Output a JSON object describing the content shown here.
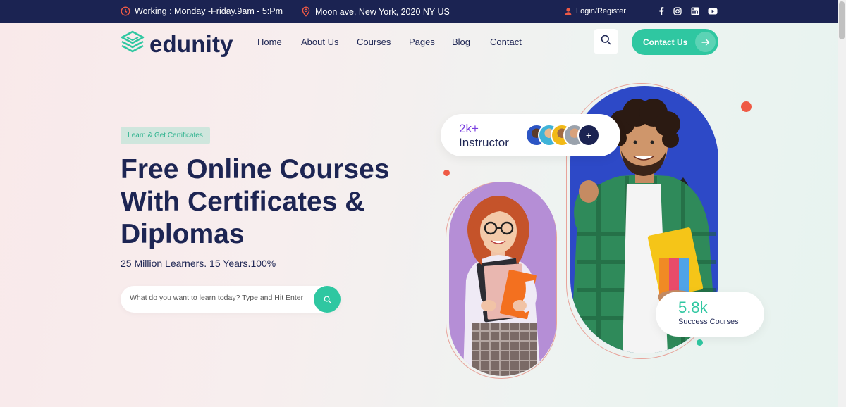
{
  "topbar": {
    "working": "Working : Monday -Friday.9am - 5:Pm",
    "address": "Moon ave, New York, 2020 NY US",
    "login": "Login/Register",
    "social": [
      "facebook-icon",
      "instagram-icon",
      "linkedin-icon",
      "youtube-icon"
    ]
  },
  "brand": {
    "name": "edunity"
  },
  "nav": {
    "items": [
      "Home",
      "About Us",
      "Courses",
      "Pages",
      "Blog",
      "Contact"
    ],
    "contact_button": "Contact Us"
  },
  "hero": {
    "tag": "Learn & Get Certificates",
    "headline": [
      "Free Online Courses",
      "With Certificates &",
      "Diplomas"
    ],
    "subline": "25 Million Learners. 15 Years.100%",
    "search_placeholder": "What do you want to learn today? Type and Hit Enter"
  },
  "stats": {
    "instructor_count": "2k+",
    "instructor_label": "Instructor",
    "instructor_more": "+",
    "courses_count": "5.8k",
    "courses_label": "Success Courses"
  },
  "colors": {
    "navy": "#1b2352",
    "accent": "#2fc7a1",
    "purple": "#7a3fe0",
    "coral": "#ef5a45",
    "blue_panel": "#2d49c7",
    "lilac_panel": "#b58ed6"
  }
}
